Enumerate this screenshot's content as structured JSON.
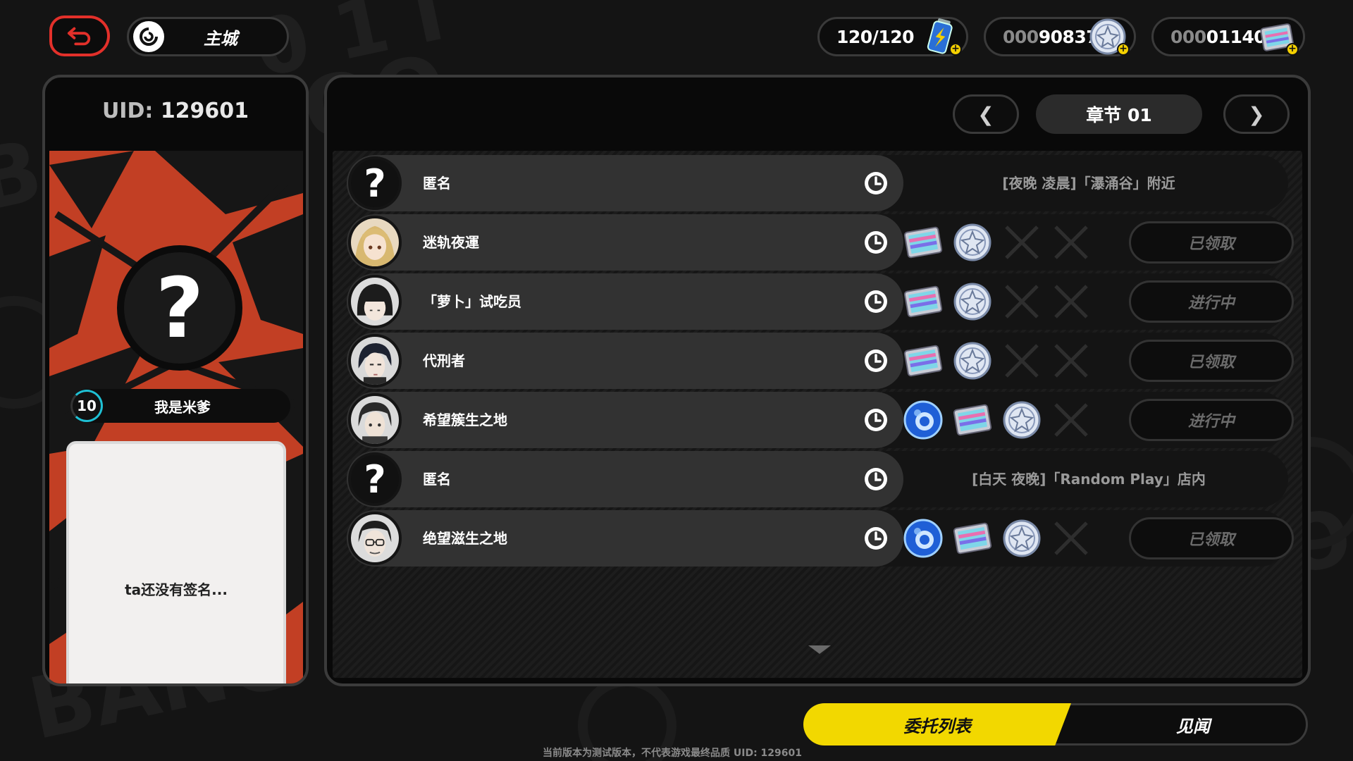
{
  "header": {
    "city_label": "主城",
    "energy": "120/120",
    "coins_dim": "000",
    "coins": "90837",
    "film_dim": "000",
    "film": "01140"
  },
  "profile": {
    "uid_label": "UID:",
    "uid_value": "129601",
    "avatar_glyph": "?",
    "level": "10",
    "name": "我是米爹",
    "signature": "ta还没有签名..."
  },
  "chapter": {
    "prev_glyph": "❮",
    "next_glyph": "❯",
    "title": "章节 01"
  },
  "commissions": [
    {
      "name": "匿名",
      "avatar": "unknown",
      "type": "location",
      "location": "[夜晚 凌晨]「瀑涌谷」附近"
    },
    {
      "name": "迷轨夜運",
      "avatar": "blonde",
      "type": "reward",
      "rewards": [
        "film-icon",
        "coin-icon",
        "empty-slot-icon",
        "empty-slot-icon"
      ],
      "status": "已领取"
    },
    {
      "name": "「萝卜」试吃员",
      "avatar": "bob-hair",
      "type": "reward",
      "rewards": [
        "film-icon",
        "coin-icon",
        "empty-slot-icon",
        "empty-slot-icon"
      ],
      "status": "进行中"
    },
    {
      "name": "代刑者",
      "avatar": "dark-hair",
      "type": "reward",
      "rewards": [
        "film-icon",
        "coin-icon",
        "empty-slot-icon",
        "empty-slot-icon"
      ],
      "status": "已领取"
    },
    {
      "name": "希望簇生之地",
      "avatar": "dark-hair-2",
      "type": "reward",
      "rewards": [
        "orb-icon",
        "film-icon",
        "coin-icon",
        "empty-slot-icon"
      ],
      "status": "进行中"
    },
    {
      "name": "匿名",
      "avatar": "unknown",
      "type": "location",
      "location": "[白天 夜晚]「Random Play」店内"
    },
    {
      "name": "绝望滋生之地",
      "avatar": "glasses",
      "type": "reward",
      "rewards": [
        "orb-icon",
        "film-icon",
        "coin-icon",
        "empty-slot-icon"
      ],
      "status": "已领取"
    }
  ],
  "tabs": {
    "active": "委托列表",
    "inactive": "见闻"
  },
  "footer_note": "当前版本为测试版本，不代表游戏最终品质   UID: 129601",
  "colors": {
    "accent_yellow": "#f2d800",
    "back_red": "#e3302a",
    "card_red": "#c23f24",
    "level_ring": "#1fc0d4"
  }
}
